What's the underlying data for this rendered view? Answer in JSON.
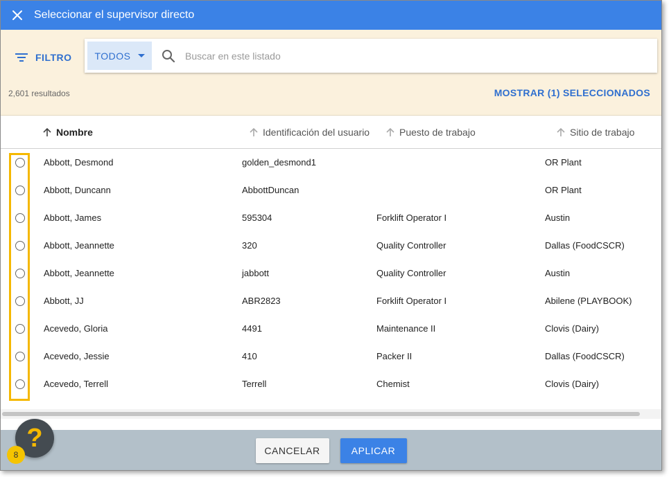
{
  "dialog": {
    "title": "Seleccionar el supervisor directo",
    "close_icon": "close-icon"
  },
  "filter": {
    "filter_label": "FILTRO",
    "dropdown_value": "TODOS",
    "search_placeholder": "Buscar en este listado",
    "search_value": "",
    "results_count": "2,601 resultados",
    "show_selected_label": "MOSTRAR (1) SELECCIONADOS"
  },
  "table": {
    "columns": [
      {
        "label": "Nombre",
        "sorted": true
      },
      {
        "label": "Identificación del usuario",
        "sorted": false
      },
      {
        "label": "Puesto de trabajo",
        "sorted": false
      },
      {
        "label": "Sitio de trabajo",
        "sorted": false
      }
    ],
    "rows": [
      {
        "name": "Abbott, Desmond",
        "user_id": "golden_desmond1",
        "job": "",
        "site": "OR Plant"
      },
      {
        "name": "Abbott, Duncann",
        "user_id": "AbbottDuncan",
        "job": "",
        "site": "OR Plant"
      },
      {
        "name": "Abbott, James",
        "user_id": "595304",
        "job": "Forklift Operator I",
        "site": "Austin"
      },
      {
        "name": "Abbott, Jeannette",
        "user_id": "320",
        "job": "Quality Controller",
        "site": "Dallas (FoodCSCR)"
      },
      {
        "name": "Abbott, Jeannette",
        "user_id": "jabbott",
        "job": "Quality Controller",
        "site": "Austin"
      },
      {
        "name": "Abbott, JJ",
        "user_id": "ABR2823",
        "job": "Forklift Operator I",
        "site": "Abilene (PLAYBOOK)"
      },
      {
        "name": "Acevedo, Gloria",
        "user_id": "4491",
        "job": "Maintenance II",
        "site": "Clovis (Dairy)"
      },
      {
        "name": "Acevedo, Jessie",
        "user_id": "410",
        "job": "Packer II",
        "site": "Dallas (FoodCSCR)"
      },
      {
        "name": "Acevedo, Terrell",
        "user_id": "Terrell",
        "job": "Chemist",
        "site": "Clovis (Dairy)"
      }
    ]
  },
  "footer": {
    "cancel_label": "CANCELAR",
    "apply_label": "APLICAR"
  },
  "help": {
    "glyph": "?",
    "badge_count": "8"
  },
  "colors": {
    "primary": "#3b82e6",
    "filter_bg": "#fbf1dd",
    "footer_bg": "#b3c0c9",
    "highlight": "#f5b800",
    "help_bg": "#444b51"
  }
}
